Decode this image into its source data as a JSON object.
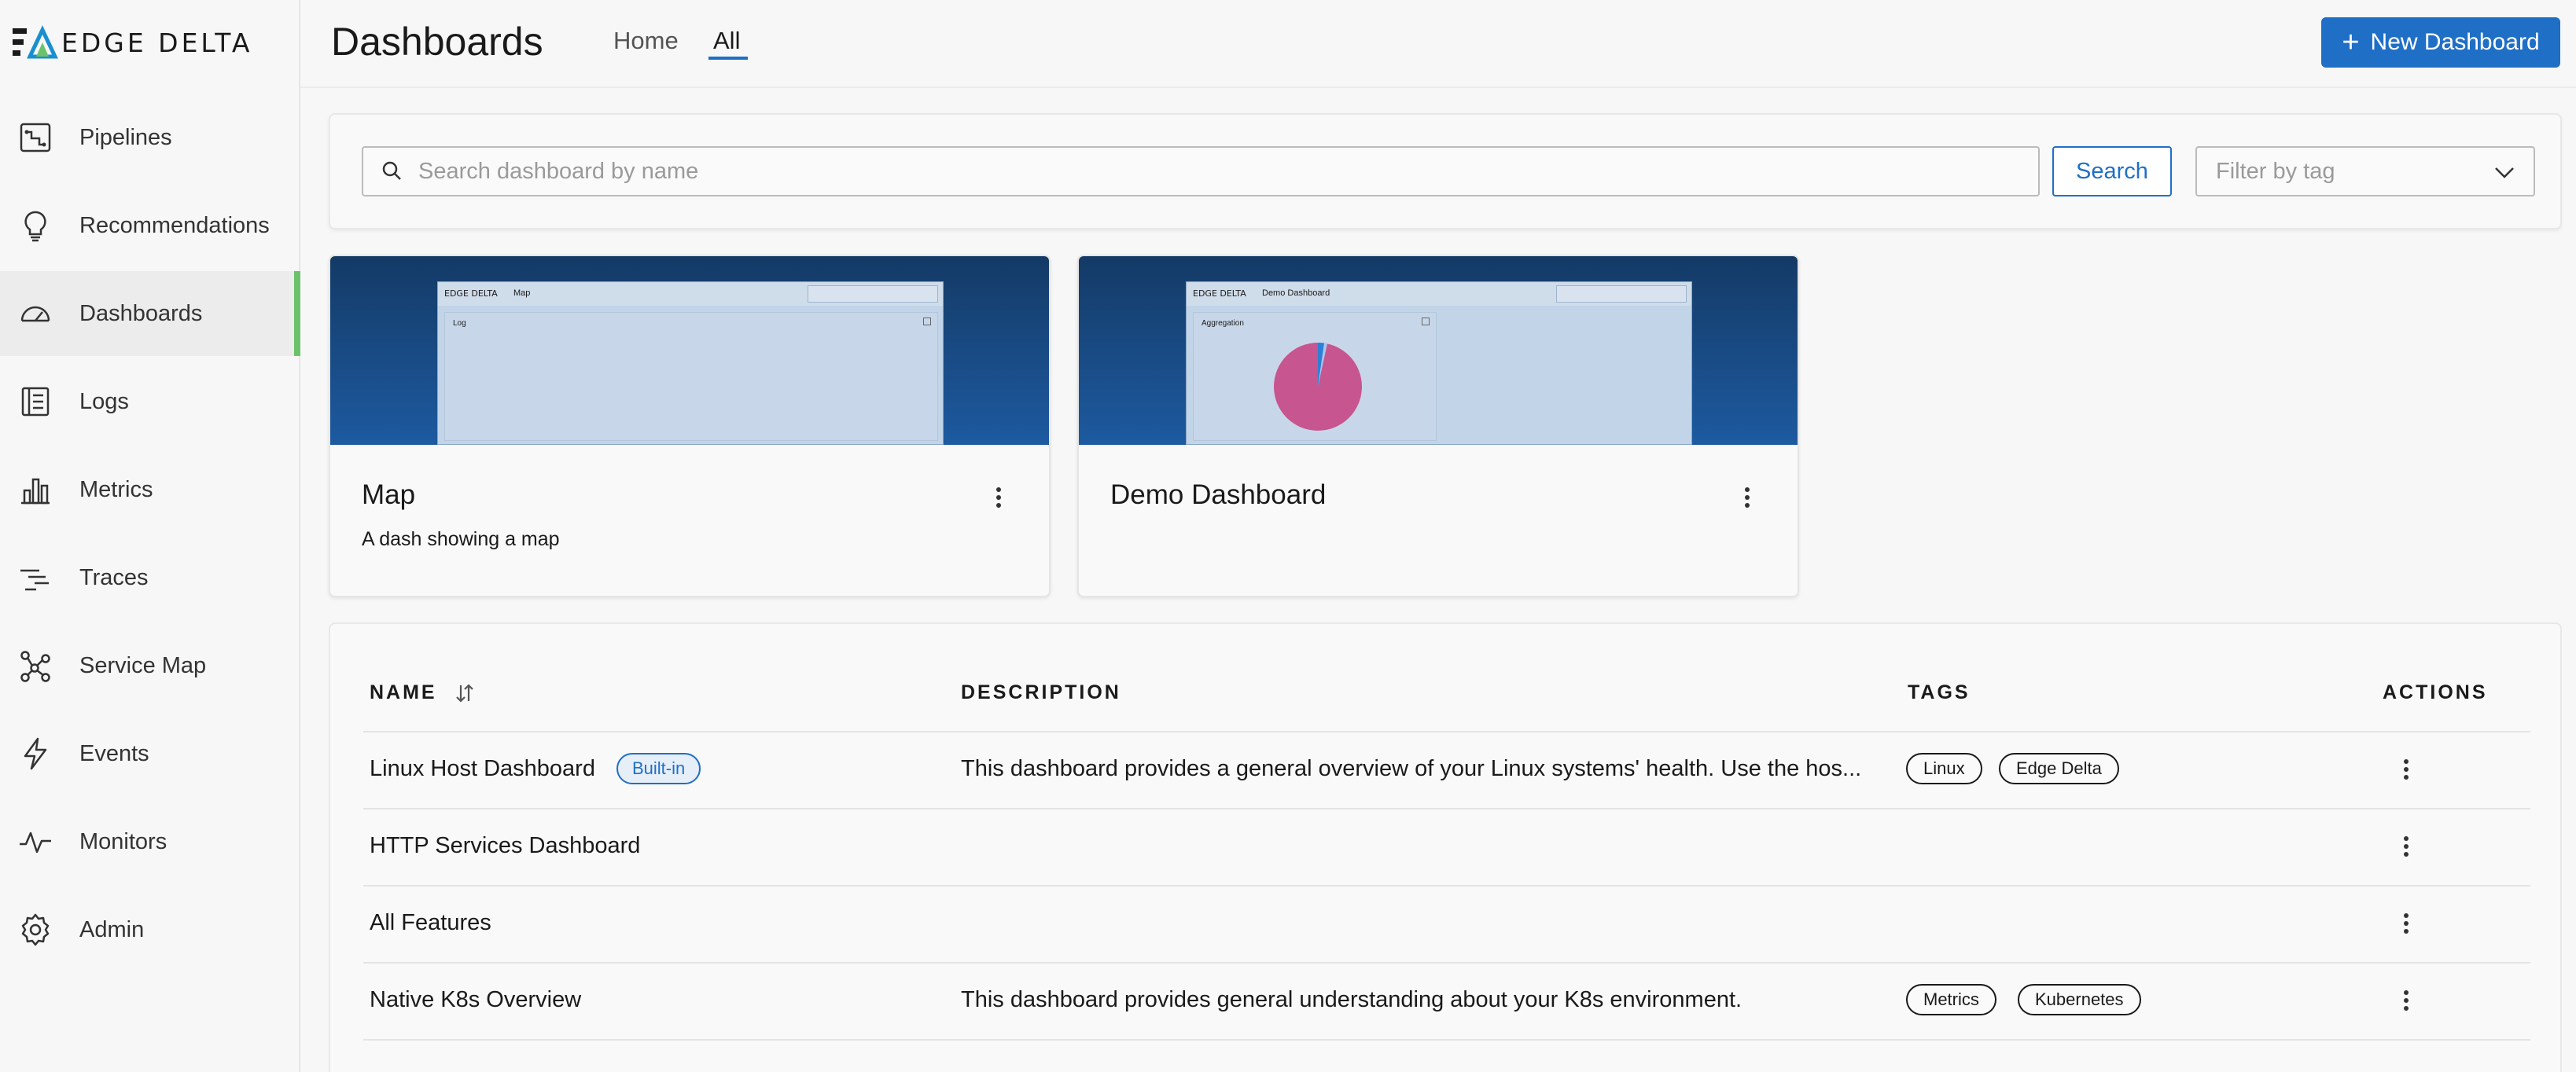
{
  "brand": {
    "logo_text": "EDGE DELTA",
    "accent": "#1f6fc6",
    "active_indicator": "#6cc26a"
  },
  "sidebar": {
    "items": [
      {
        "label": "Pipelines",
        "icon": "pipelines-icon"
      },
      {
        "label": "Recommendations",
        "icon": "lightbulb-icon"
      },
      {
        "label": "Dashboards",
        "icon": "gauge-icon",
        "active": true
      },
      {
        "label": "Logs",
        "icon": "logs-icon"
      },
      {
        "label": "Metrics",
        "icon": "bar-chart-icon"
      },
      {
        "label": "Traces",
        "icon": "traces-icon"
      },
      {
        "label": "Service Map",
        "icon": "service-map-icon"
      },
      {
        "label": "Events",
        "icon": "lightning-icon"
      },
      {
        "label": "Monitors",
        "icon": "pulse-icon"
      },
      {
        "label": "Admin",
        "icon": "gear-icon"
      }
    ]
  },
  "header": {
    "title": "Dashboards",
    "tabs": [
      {
        "label": "Home"
      },
      {
        "label": "All",
        "active": true
      }
    ],
    "new_button": "New Dashboard"
  },
  "search": {
    "placeholder": "Search dashboard by name",
    "value": "",
    "button": "Search",
    "tag_filter_placeholder": "Filter by tag"
  },
  "cards": [
    {
      "title": "Map",
      "description": "A dash showing a map",
      "thumb": {
        "logo": "EDGE DELTA",
        "title": "Map",
        "panel_label": "Log"
      }
    },
    {
      "title": "Demo Dashboard",
      "description": "",
      "thumb": {
        "logo": "EDGE DELTA",
        "title": "Demo Dashboard",
        "panel_label": "Aggregation"
      }
    }
  ],
  "table": {
    "headers": {
      "name": "NAME",
      "description": "DESCRIPTION",
      "tags": "TAGS",
      "actions": "ACTIONS"
    },
    "rows": [
      {
        "name": "Linux Host Dashboard",
        "badge": "Built-in",
        "description": "This dashboard provides a general overview of your Linux systems' health. Use the hos...",
        "tags": [
          "Linux",
          "Edge Delta"
        ]
      },
      {
        "name": "HTTP Services Dashboard",
        "badge": "",
        "description": "",
        "tags": []
      },
      {
        "name": "All Features",
        "badge": "",
        "description": "",
        "tags": []
      },
      {
        "name": "Native K8s Overview",
        "badge": "",
        "description": "This dashboard provides general understanding about your K8s environment.",
        "tags": [
          "Metrics",
          "Kubernetes"
        ]
      }
    ]
  }
}
